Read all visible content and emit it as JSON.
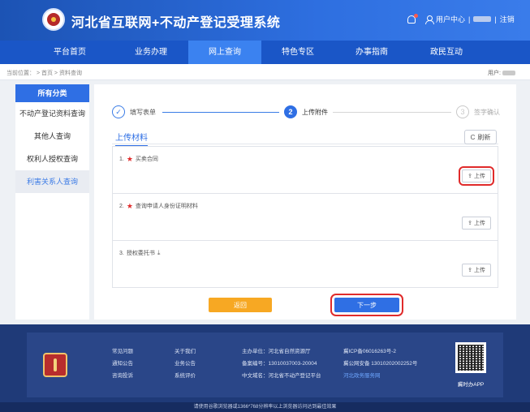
{
  "header": {
    "site_title": "河北省互联网+不动产登记受理系统",
    "user_center": "用户中心",
    "separator": "|",
    "logout": "注销"
  },
  "nav": {
    "items": [
      "平台首页",
      "业务办理",
      "网上查询",
      "特色专区",
      "办事指南",
      "政民互动"
    ],
    "active_index": 2
  },
  "breadcrumb": {
    "text": "当前位置： > 首页 > 资料查询",
    "user_label": "用户:"
  },
  "sidebar": {
    "heading": "所有分类",
    "items": [
      "不动产登记资料查询",
      "其他人查询",
      "权利人授权查询",
      "利害关系人查询"
    ],
    "active_index": 3
  },
  "steps": {
    "items": [
      {
        "number": "✓",
        "label": "填写表单",
        "state": "done"
      },
      {
        "number": "2",
        "label": "上传附件",
        "state": "current"
      },
      {
        "number": "3",
        "label": "签字确认",
        "state": "pending"
      }
    ]
  },
  "upload": {
    "section_title": "上传材料",
    "refresh_label": "刷新",
    "upload_label": "上传",
    "documents": [
      {
        "index": "1.",
        "required": true,
        "name": "买卖合同",
        "downloadable": false
      },
      {
        "index": "2.",
        "required": true,
        "name": "查询申请人身份证明材料",
        "downloadable": false
      },
      {
        "index": "3.",
        "required": false,
        "name": "授权委托书",
        "downloadable": true
      }
    ]
  },
  "actions": {
    "back_label": "返回",
    "next_label": "下一步"
  },
  "footer": {
    "links_col1": [
      "常见问题",
      "通知公告",
      "咨询投诉"
    ],
    "links_col2": [
      "关于我们",
      "业务公告",
      "系统评价"
    ],
    "info": [
      "主办单位：河北省自然资源厅",
      "备案编号：13010037003-20004",
      "中文域名：河北省不动产登记平台"
    ],
    "icp": [
      "冀ICP备06016263号-2",
      "冀公网安备 13010202002252号",
      "河北政务服务网"
    ],
    "app_label": "冀时办APP",
    "browser_notice": "请使用谷歌浏览器或1366*768分辨率以上浏览器访问达到最佳效果"
  },
  "colors": {
    "primary": "#2f6fe4",
    "nav_bg": "#1a56c7",
    "back_button": "#f7a823",
    "highlight": "#e02b2b",
    "footer_bg": "#1f3a78"
  }
}
